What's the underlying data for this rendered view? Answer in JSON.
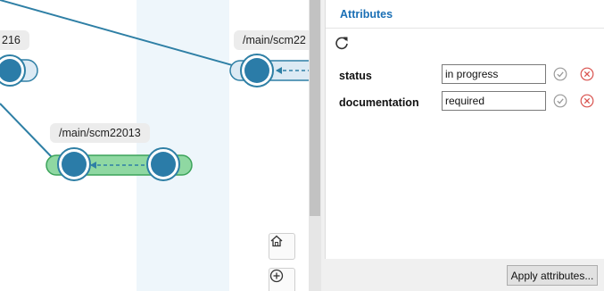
{
  "graph": {
    "branch_labels": [
      "216",
      "/main/scm22013",
      "/main/scm22"
    ]
  },
  "panel": {
    "title": "Attributes",
    "refresh_icon": "refresh-icon",
    "attributes": [
      {
        "label": "status",
        "value": "in progress"
      },
      {
        "label": "documentation",
        "value": "required"
      }
    ],
    "accept_icon": "check-circle-icon",
    "remove_icon": "x-circle-icon"
  },
  "navigation": {
    "home_icon": "home-icon",
    "zoom_in_icon": "zoom-in-icon"
  },
  "footer": {
    "apply_label": "Apply attributes..."
  },
  "colors": {
    "node": "#2b7ca8",
    "node_ring": "#1f5f88",
    "active_branch": "#8fd8a2",
    "active_branch_border": "#3ca35a",
    "lane_background": "#eef6fb",
    "title_accent": "#1a6fb5",
    "remove_red": "#d9534f",
    "accept_grey": "#9a9a9a"
  }
}
